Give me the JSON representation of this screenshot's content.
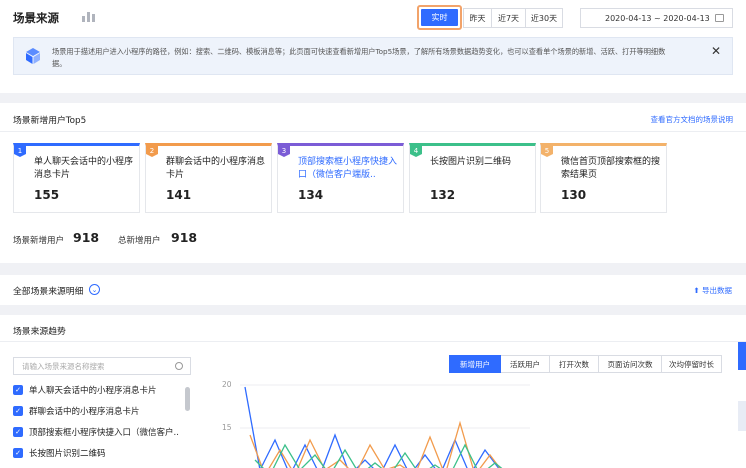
{
  "header": {
    "title": "场景来源",
    "ranges": [
      "实时",
      "昨天",
      "近7天",
      "近30天"
    ],
    "date_range": "2020-04-13 ~ 2020-04-13",
    "notice": "场景用于描述用户进入小程序的路径，例如：搜索、二维码、模板消息等；此页面可快速查看新增用户Top5场景，了解所有场景数据趋势变化，也可以查看单个场景的新增、活跃、打开等明细数据。",
    "close": "✕"
  },
  "top5": {
    "title": "场景新增用户Top5",
    "doc_link": "查看官方文档的场景说明",
    "cards": [
      {
        "rank": "1",
        "name": "单人聊天会话中的小程序消息卡片",
        "value": "155",
        "color": "#2f6bff"
      },
      {
        "rank": "2",
        "name": "群聊会话中的小程序消息卡片",
        "value": "141",
        "color": "#f29b4c"
      },
      {
        "rank": "3",
        "name": "顶部搜索框小程序快捷入口（微信客户端版..",
        "value": "134",
        "color": "#7b5cd6"
      },
      {
        "rank": "4",
        "name": "长按图片识别二维码",
        "value": "132",
        "color": "#3cc08a"
      },
      {
        "rank": "5",
        "name": "微信首页顶部搜索框的搜索结果页",
        "value": "130",
        "color": "#f3b26a"
      }
    ],
    "scene_new_label": "场景新增用户",
    "scene_new_value": "918",
    "total_new_label": "总新增用户",
    "total_new_value": "918"
  },
  "detail": {
    "title": "全部场景来源明细",
    "export": "导出数据"
  },
  "trend": {
    "title": "场景来源趋势",
    "search_placeholder": "请输入场景来源名称搜索",
    "items": [
      "单人聊天会话中的小程序消息卡片",
      "群聊会话中的小程序消息卡片",
      "顶部搜索框小程序快捷入口（微信客户..",
      "长按图片识别二维码"
    ],
    "tabs": [
      "新增用户",
      "活跃用户",
      "打开次数",
      "页面访问次数",
      "次均停留时长"
    ],
    "y_ticks": [
      "20",
      "15"
    ]
  }
}
